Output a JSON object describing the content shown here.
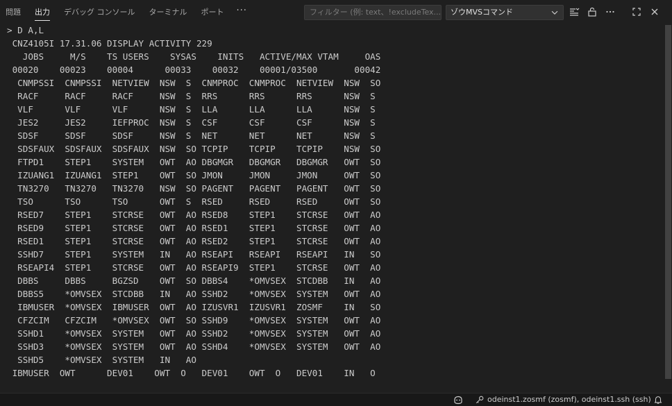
{
  "tabs": [
    {
      "label": "問題",
      "active": false
    },
    {
      "label": "出力",
      "active": true
    },
    {
      "label": "デバッグ コンソール",
      "active": false
    },
    {
      "label": "ターミナル",
      "active": false
    },
    {
      "label": "ポート",
      "active": false
    }
  ],
  "more_tabs_label": "···",
  "filter": {
    "placeholder": "フィルター (例: text、!excludeTex..."
  },
  "channel_select": {
    "value": "ゾウMVSコマンド"
  },
  "toolbar_icons": [
    "filter-lines-icon",
    "lock-icon",
    "more-actions-icon",
    "maximize-icon",
    "close-icon"
  ],
  "output_lines": [
    "> D A,L",
    " CNZ4105I 17.31.06 DISPLAY ACTIVITY 229",
    "   JOBS     M/S    TS USERS    SYSAS    INITS   ACTIVE/MAX VTAM     OAS",
    " 00020    00023    00004      00033    00032    00001/03500       00042",
    "  CNMPSSI  CNMPSSI  NETVIEW  NSW  S  CNMPROC  CNMPROC  NETVIEW  NSW  SO",
    "  RACF     RACF     RACF     NSW  S  RRS      RRS      RRS      NSW  S",
    "  VLF      VLF      VLF      NSW  S  LLA      LLA      LLA      NSW  S",
    "  JES2     JES2     IEFPROC  NSW  S  CSF      CSF      CSF      NSW  S",
    "  SDSF     SDSF     SDSF     NSW  S  NET      NET      NET      NSW  S",
    "  SDSFAUX  SDSFAUX  SDSFAUX  NSW  SO TCPIP    TCPIP    TCPIP    NSW  SO",
    "  FTPD1    STEP1    SYSTEM   OWT  AO DBGMGR   DBGMGR   DBGMGR   OWT  SO",
    "  IZUANG1  IZUANG1  STEP1    OWT  SO JMON     JMON     JMON     OWT  SO",
    "  TN3270   TN3270   TN3270   NSW  SO PAGENT   PAGENT   PAGENT   OWT  SO",
    "  TSO      TSO      TSO      OWT  S  RSED     RSED     RSED     OWT  SO",
    "  RSED7    STEP1    STCRSE   OWT  AO RSED8    STEP1    STCRSE   OWT  AO",
    "  RSED9    STEP1    STCRSE   OWT  AO RSED1    STEP1    STCRSE   OWT  AO",
    "  RSED1    STEP1    STCRSE   OWT  AO RSED2    STEP1    STCRSE   OWT  AO",
    "  SSHD7    STEP1    SYSTEM   IN   AO RSEAPI   RSEAPI   RSEAPI   IN   SO",
    "  RSEAPI4  STEP1    STCRSE   OWT  AO RSEAPI9  STEP1    STCRSE   OWT  AO",
    "  DBBS     DBBS     BGZSD    OWT  SO DBBS4    *OMVSEX  STCDBB   IN   AO",
    "  DBBS5    *OMVSEX  STCDBB   IN   AO SSHD2    *OMVSEX  SYSTEM   OWT  AO",
    "  IBMUSER  *OMVSEX  IBMUSER  OWT  AO IZUSVR1  IZUSVR1  ZOSMF    IN   SO",
    "  CFZCIM   CFZCIM   *OMVSEX  OWT  SO SSHD9    *OMVSEX  SYSTEM   OWT  AO",
    "  SSHD1    *OMVSEX  SYSTEM   OWT  AO SSHD2    *OMVSEX  SYSTEM   OWT  AO",
    "  SSHD3    *OMVSEX  SYSTEM   OWT  AO SSHD4    *OMVSEX  SYSTEM   OWT  AO",
    "  SSHD5    *OMVSEX  SYSTEM   IN   AO",
    " IBMUSER  OWT      DEV01    OWT  O   DEV01    OWT  O   DEV01    IN   O"
  ],
  "status_bar": {
    "connection_label": "odeinst1.zosmf (zosmf), odeinst1.ssh (ssh)"
  },
  "colors": {
    "background": "#1f1f1f",
    "text": "#cccccc",
    "status_bar": "#181818"
  }
}
